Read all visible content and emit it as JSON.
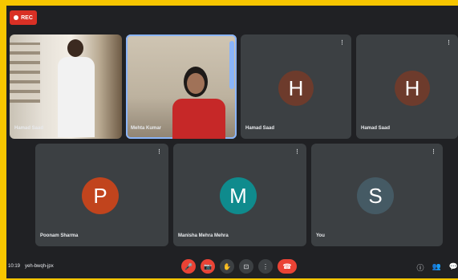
{
  "recording": {
    "label": "REC"
  },
  "participants": [
    {
      "name": "Hamad Saad",
      "initial": "",
      "type": "video"
    },
    {
      "name": "Mehta Kumar",
      "initial": "",
      "type": "video"
    },
    {
      "name": "Hamad Saad",
      "initial": "H",
      "color": "#6d3b2c"
    },
    {
      "name": "Hamad Saad",
      "initial": "H",
      "color": "#6d3b2c"
    },
    {
      "name": "Poonam Sharma",
      "initial": "P",
      "color": "#c1441d"
    },
    {
      "name": "Manisha Mehra Mehra",
      "initial": "M",
      "color": "#0f8b8d"
    },
    {
      "name": "You",
      "initial": "S",
      "color": "#455a64"
    }
  ],
  "more_indicator": "⋮",
  "meeting": {
    "time": "10:19",
    "code": "yeh-bwqh-jpx"
  },
  "controls": {
    "mic": "🎤",
    "camera": "📷",
    "hand": "✋",
    "present": "⊡",
    "more": "⋮",
    "end": "☎"
  },
  "right": {
    "info": "ⓘ",
    "people": "👥",
    "chat": "💬",
    "count": "8"
  }
}
